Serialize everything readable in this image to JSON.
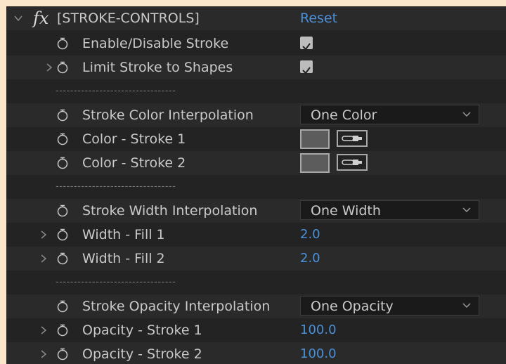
{
  "effect": {
    "name": "[STROKE-CONTROLS]",
    "reset_label": "Reset",
    "fx_label": "fx"
  },
  "separator_text": "---------------------------------",
  "properties": {
    "enable_disable_stroke": {
      "label": "Enable/Disable Stroke",
      "checked": true
    },
    "limit_stroke_to_shapes": {
      "label": "Limit Stroke to Shapes",
      "checked": true
    },
    "stroke_color_interpolation": {
      "label": "Stroke Color Interpolation",
      "selected": "One Color"
    },
    "color_stroke_1": {
      "label": "Color - Stroke 1",
      "color": "#5c5c5c"
    },
    "color_stroke_2": {
      "label": "Color - Stroke 2",
      "color": "#5c5c5c"
    },
    "stroke_width_interpolation": {
      "label": "Stroke Width Interpolation",
      "selected": "One Width"
    },
    "width_fill_1": {
      "label": "Width - Fill 1",
      "value": "2.0"
    },
    "width_fill_2": {
      "label": "Width - Fill 2",
      "value": "2.0"
    },
    "stroke_opacity_interpolation": {
      "label": "Stroke Opacity Interpolation",
      "selected": "One Opacity"
    },
    "opacity_stroke_1": {
      "label": "Opacity - Stroke 1",
      "value": "100.0"
    },
    "opacity_stroke_2": {
      "label": "Opacity - Stroke 2",
      "value": "100.0"
    }
  },
  "colors": {
    "panel_bg": "#232323",
    "value_blue": "#4a90d9",
    "page_bg": "#fbe6cc"
  }
}
